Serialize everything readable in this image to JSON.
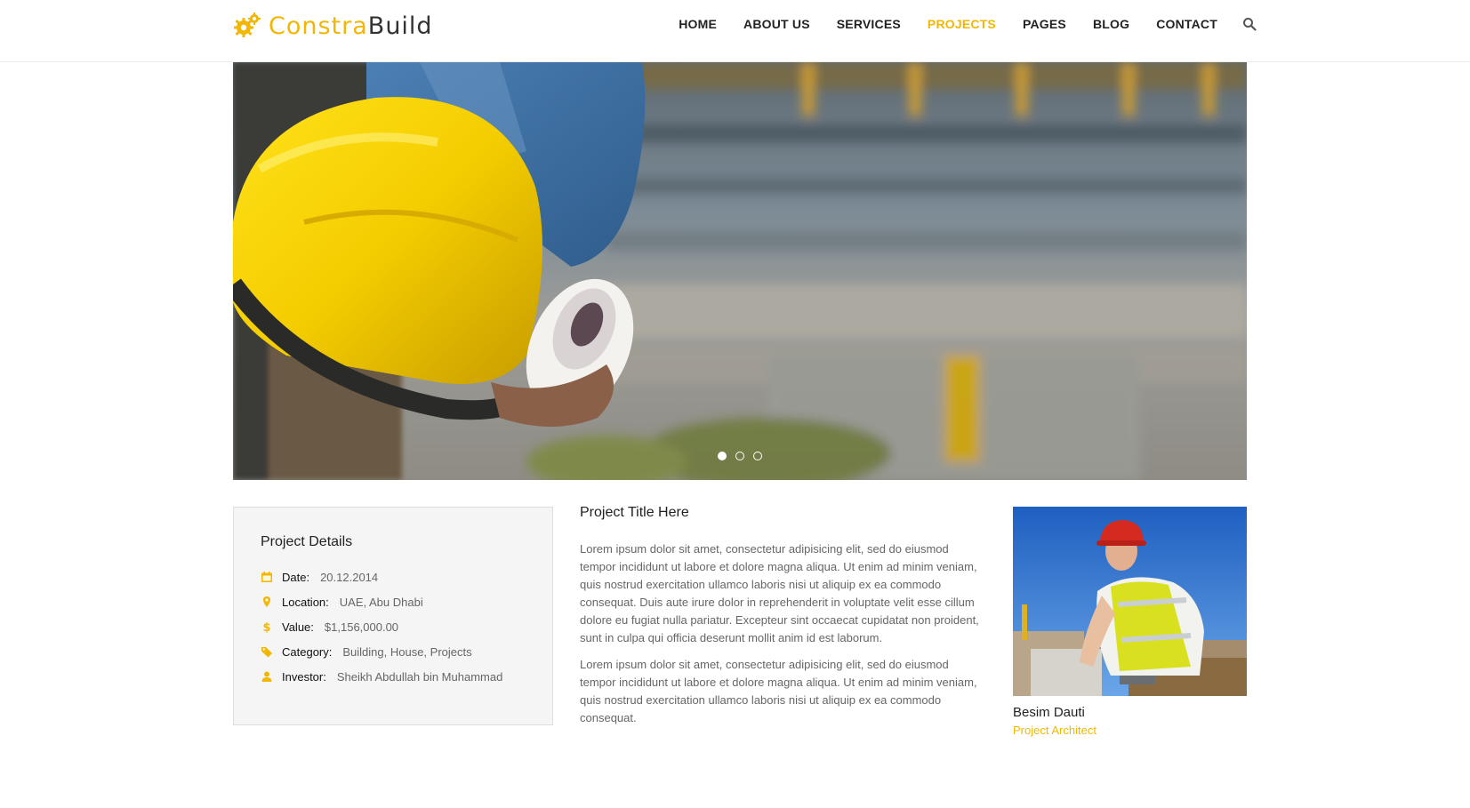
{
  "brand": {
    "name_part1": "Constra",
    "name_part2": "Build",
    "accent_color": "#f2b705"
  },
  "nav": {
    "items": [
      {
        "label": "HOME",
        "active": false
      },
      {
        "label": "ABOUT US",
        "active": false
      },
      {
        "label": "SERVICES",
        "active": false
      },
      {
        "label": "PROJECTS",
        "active": true
      },
      {
        "label": "PAGES",
        "active": false
      },
      {
        "label": "BLOG",
        "active": false
      },
      {
        "label": "CONTACT",
        "active": false
      }
    ],
    "search_icon": "search-icon"
  },
  "slider": {
    "slide_count": 3,
    "active_slide": 1
  },
  "details": {
    "title": "Project Details",
    "rows": [
      {
        "icon": "calendar-icon",
        "label": "Date:",
        "value": "20.12.2014"
      },
      {
        "icon": "map-marker-icon",
        "label": "Location:",
        "value": "UAE, Abu Dhabi"
      },
      {
        "icon": "dollar-icon",
        "label": "Value:",
        "value": "$1,156,000.00"
      },
      {
        "icon": "tag-icon",
        "label": "Category:",
        "value": "Building, House, Projects"
      },
      {
        "icon": "user-icon",
        "label": "Investor:",
        "value": "Sheikh Abdullah bin Muhammad"
      }
    ]
  },
  "project": {
    "title": "Project Title Here",
    "paragraphs": [
      "Lorem ipsum dolor sit amet, consectetur adipisicing elit, sed do eiusmod tempor incididunt ut labore et dolore magna aliqua. Ut enim ad minim veniam, quis nostrud exercitation ullamco laboris nisi ut aliquip ex ea commodo consequat. Duis aute irure dolor in reprehenderit in voluptate velit esse cillum dolore eu fugiat nulla pariatur. Excepteur sint occaecat cupidatat non proident, sunt in culpa qui officia deserunt mollit anim id est laborum.",
      "Lorem ipsum dolor sit amet, consectetur adipisicing elit, sed do eiusmod tempor incididunt ut labore et dolore magna aliqua. Ut enim ad minim veniam, quis nostrud exercitation ullamco laboris nisi ut aliquip ex ea commodo consequat."
    ]
  },
  "team": {
    "name": "Besim Dauti",
    "role": "Project Architect"
  }
}
